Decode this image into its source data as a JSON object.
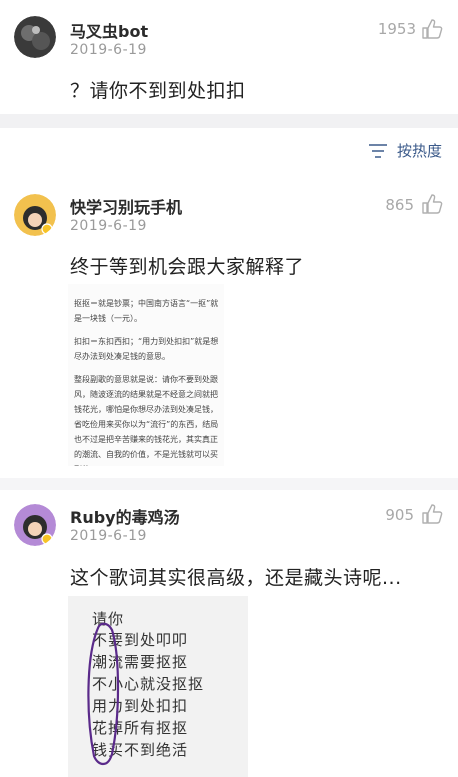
{
  "comments": [
    {
      "username": "马叉虫bot",
      "date": "2019-6-19",
      "likes": "1953",
      "text": "？请你不到到处扣扣"
    },
    {
      "username": "快学习别玩手机",
      "date": "2019-6-19",
      "likes": "865",
      "text": "终于等到机会跟大家解释了"
    },
    {
      "username": "Ruby的毒鸡汤",
      "date": "2019-6-19",
      "likes": "905",
      "text": "这个歌词其实很高级，还是藏头诗呢..."
    }
  ],
  "sort": {
    "label": "按热度",
    "icon": "sort-icon"
  },
  "article_image": {
    "p1": "抠抠＝就是钞票；中国南方语言“一抠”就",
    "p1b": "是一块钱（一元）。",
    "p2": "扣扣＝东扣西扣；“用力到处扣扣”就是想",
    "p2b": "尽办法到处凑足钱的意思。",
    "p3a": "整段副歌的意思就是说：请你不要到处跟",
    "p3b": "风，随波逐流的结果就是不经意之间就把",
    "p3c": "钱花光，哪怕是你想尽办法到处凑足钱，",
    "p3d": "省吃俭用来买你以为“流行”的东西，结局",
    "p3e": "也不过是把辛苦赚来的钱花光，其实真正",
    "p3f": "的潮流、自我的价值，不是光钱就可以买",
    "p3g": "到的"
  },
  "poem_image": {
    "lines": [
      "请你",
      "不要到处叩叩",
      "潮流需要抠抠",
      "不小心就没抠抠",
      "用力到处扣扣",
      "花掉所有抠抠",
      "钱买不到绝活"
    ]
  }
}
